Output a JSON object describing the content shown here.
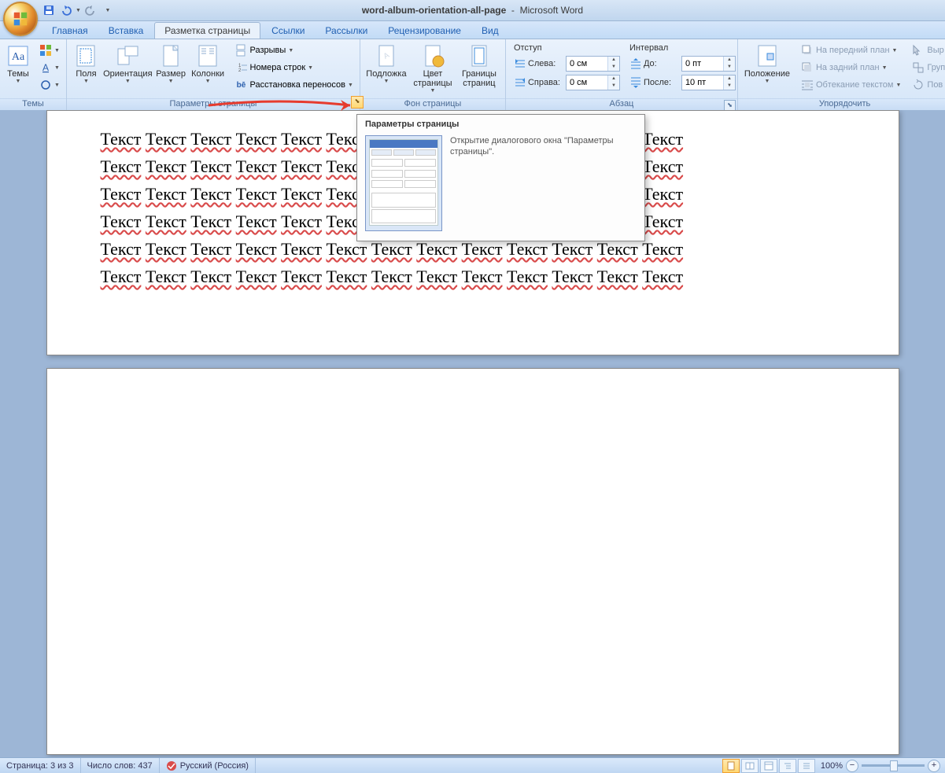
{
  "title": {
    "doc": "word-album-orientation-all-page",
    "app": "Microsoft Word"
  },
  "qat": {
    "save": "save-icon",
    "undo": "undo-icon",
    "redo": "redo-icon"
  },
  "tabs": [
    "Главная",
    "Вставка",
    "Разметка страницы",
    "Ссылки",
    "Рассылки",
    "Рецензирование",
    "Вид"
  ],
  "activeTab": 2,
  "ribbon": {
    "themes": {
      "label": "Темы",
      "btn": "Темы"
    },
    "pageSetup": {
      "label": "Параметры страницы",
      "margins": "Поля",
      "orientation": "Ориентация",
      "size": "Размер",
      "columns": "Колонки",
      "breaks": "Разрывы",
      "lineNumbers": "Номера строк",
      "hyphenation": "Расстановка переносов"
    },
    "pageBg": {
      "label": "Фон страницы",
      "watermark": "Подложка",
      "pageColor": "Цвет страницы",
      "borders": "Границы страниц"
    },
    "paragraph": {
      "label": "Абзац",
      "indent": "Отступ",
      "indentLeft": "Слева:",
      "indentRight": "Справа:",
      "indentLeftVal": "0 см",
      "indentRightVal": "0 см",
      "spacing": "Интервал",
      "before": "До:",
      "after": "После:",
      "beforeVal": "0 пт",
      "afterVal": "10 пт"
    },
    "arrange": {
      "label": "Упорядочить",
      "position": "Положение",
      "bringFront": "На передний план",
      "sendBack": "На задний план",
      "textWrap": "Обтекание текстом",
      "selIcon": "Выр",
      "groupIcon": "Груп",
      "rotIcon": "Пов"
    }
  },
  "tooltip": {
    "title": "Параметры страницы",
    "desc": "Открытие диалогового окна \"Параметры страницы\"."
  },
  "doc": {
    "word": "Текст",
    "wordsPerLine": 13,
    "lines": 6
  },
  "status": {
    "page": "Страница: 3 из 3",
    "words": "Число слов: 437",
    "lang": "Русский (Россия)",
    "zoom": "100%"
  }
}
